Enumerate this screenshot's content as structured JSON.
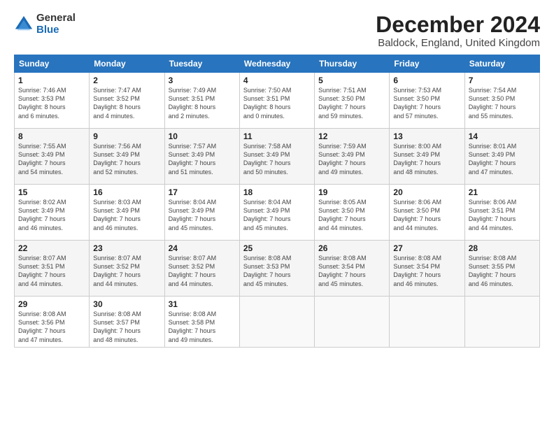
{
  "logo": {
    "general": "General",
    "blue": "Blue"
  },
  "title": "December 2024",
  "subtitle": "Baldock, England, United Kingdom",
  "headers": [
    "Sunday",
    "Monday",
    "Tuesday",
    "Wednesday",
    "Thursday",
    "Friday",
    "Saturday"
  ],
  "weeks": [
    [
      {
        "day": "1",
        "info": "Sunrise: 7:46 AM\nSunset: 3:53 PM\nDaylight: 8 hours\nand 6 minutes."
      },
      {
        "day": "2",
        "info": "Sunrise: 7:47 AM\nSunset: 3:52 PM\nDaylight: 8 hours\nand 4 minutes."
      },
      {
        "day": "3",
        "info": "Sunrise: 7:49 AM\nSunset: 3:51 PM\nDaylight: 8 hours\nand 2 minutes."
      },
      {
        "day": "4",
        "info": "Sunrise: 7:50 AM\nSunset: 3:51 PM\nDaylight: 8 hours\nand 0 minutes."
      },
      {
        "day": "5",
        "info": "Sunrise: 7:51 AM\nSunset: 3:50 PM\nDaylight: 7 hours\nand 59 minutes."
      },
      {
        "day": "6",
        "info": "Sunrise: 7:53 AM\nSunset: 3:50 PM\nDaylight: 7 hours\nand 57 minutes."
      },
      {
        "day": "7",
        "info": "Sunrise: 7:54 AM\nSunset: 3:50 PM\nDaylight: 7 hours\nand 55 minutes."
      }
    ],
    [
      {
        "day": "8",
        "info": "Sunrise: 7:55 AM\nSunset: 3:49 PM\nDaylight: 7 hours\nand 54 minutes."
      },
      {
        "day": "9",
        "info": "Sunrise: 7:56 AM\nSunset: 3:49 PM\nDaylight: 7 hours\nand 52 minutes."
      },
      {
        "day": "10",
        "info": "Sunrise: 7:57 AM\nSunset: 3:49 PM\nDaylight: 7 hours\nand 51 minutes."
      },
      {
        "day": "11",
        "info": "Sunrise: 7:58 AM\nSunset: 3:49 PM\nDaylight: 7 hours\nand 50 minutes."
      },
      {
        "day": "12",
        "info": "Sunrise: 7:59 AM\nSunset: 3:49 PM\nDaylight: 7 hours\nand 49 minutes."
      },
      {
        "day": "13",
        "info": "Sunrise: 8:00 AM\nSunset: 3:49 PM\nDaylight: 7 hours\nand 48 minutes."
      },
      {
        "day": "14",
        "info": "Sunrise: 8:01 AM\nSunset: 3:49 PM\nDaylight: 7 hours\nand 47 minutes."
      }
    ],
    [
      {
        "day": "15",
        "info": "Sunrise: 8:02 AM\nSunset: 3:49 PM\nDaylight: 7 hours\nand 46 minutes."
      },
      {
        "day": "16",
        "info": "Sunrise: 8:03 AM\nSunset: 3:49 PM\nDaylight: 7 hours\nand 46 minutes."
      },
      {
        "day": "17",
        "info": "Sunrise: 8:04 AM\nSunset: 3:49 PM\nDaylight: 7 hours\nand 45 minutes."
      },
      {
        "day": "18",
        "info": "Sunrise: 8:04 AM\nSunset: 3:49 PM\nDaylight: 7 hours\nand 45 minutes."
      },
      {
        "day": "19",
        "info": "Sunrise: 8:05 AM\nSunset: 3:50 PM\nDaylight: 7 hours\nand 44 minutes."
      },
      {
        "day": "20",
        "info": "Sunrise: 8:06 AM\nSunset: 3:50 PM\nDaylight: 7 hours\nand 44 minutes."
      },
      {
        "day": "21",
        "info": "Sunrise: 8:06 AM\nSunset: 3:51 PM\nDaylight: 7 hours\nand 44 minutes."
      }
    ],
    [
      {
        "day": "22",
        "info": "Sunrise: 8:07 AM\nSunset: 3:51 PM\nDaylight: 7 hours\nand 44 minutes."
      },
      {
        "day": "23",
        "info": "Sunrise: 8:07 AM\nSunset: 3:52 PM\nDaylight: 7 hours\nand 44 minutes."
      },
      {
        "day": "24",
        "info": "Sunrise: 8:07 AM\nSunset: 3:52 PM\nDaylight: 7 hours\nand 44 minutes."
      },
      {
        "day": "25",
        "info": "Sunrise: 8:08 AM\nSunset: 3:53 PM\nDaylight: 7 hours\nand 45 minutes."
      },
      {
        "day": "26",
        "info": "Sunrise: 8:08 AM\nSunset: 3:54 PM\nDaylight: 7 hours\nand 45 minutes."
      },
      {
        "day": "27",
        "info": "Sunrise: 8:08 AM\nSunset: 3:54 PM\nDaylight: 7 hours\nand 46 minutes."
      },
      {
        "day": "28",
        "info": "Sunrise: 8:08 AM\nSunset: 3:55 PM\nDaylight: 7 hours\nand 46 minutes."
      }
    ],
    [
      {
        "day": "29",
        "info": "Sunrise: 8:08 AM\nSunset: 3:56 PM\nDaylight: 7 hours\nand 47 minutes."
      },
      {
        "day": "30",
        "info": "Sunrise: 8:08 AM\nSunset: 3:57 PM\nDaylight: 7 hours\nand 48 minutes."
      },
      {
        "day": "31",
        "info": "Sunrise: 8:08 AM\nSunset: 3:58 PM\nDaylight: 7 hours\nand 49 minutes."
      },
      {
        "day": "",
        "info": ""
      },
      {
        "day": "",
        "info": ""
      },
      {
        "day": "",
        "info": ""
      },
      {
        "day": "",
        "info": ""
      }
    ]
  ]
}
